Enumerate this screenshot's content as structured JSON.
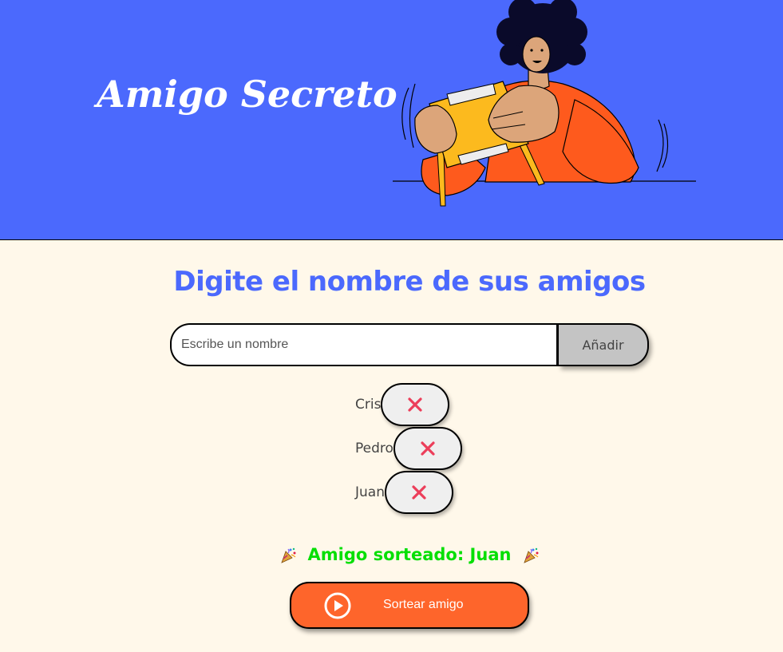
{
  "header": {
    "title": "Amigo Secreto",
    "background": "#4B69FD",
    "illustration": "person-holding-gift-box"
  },
  "main": {
    "background": "#FFF8EA",
    "section_title": "Digite el nombre de sus amigos",
    "input": {
      "placeholder": "Escribe un nombre",
      "value": ""
    },
    "add_button_label": "Añadir",
    "friends": [
      {
        "name": "Cris",
        "remove_icon": "close-icon"
      },
      {
        "name": "Pedro",
        "remove_icon": "close-icon"
      },
      {
        "name": "Juan",
        "remove_icon": "close-icon"
      }
    ],
    "result": {
      "text": "Amigo sorteado: Juan",
      "icon": "party-popper-icon",
      "color": "#05DF05"
    },
    "draw_button": {
      "label": "Sortear amigo",
      "icon": "play-circle-icon",
      "color": "#FE652B"
    }
  }
}
